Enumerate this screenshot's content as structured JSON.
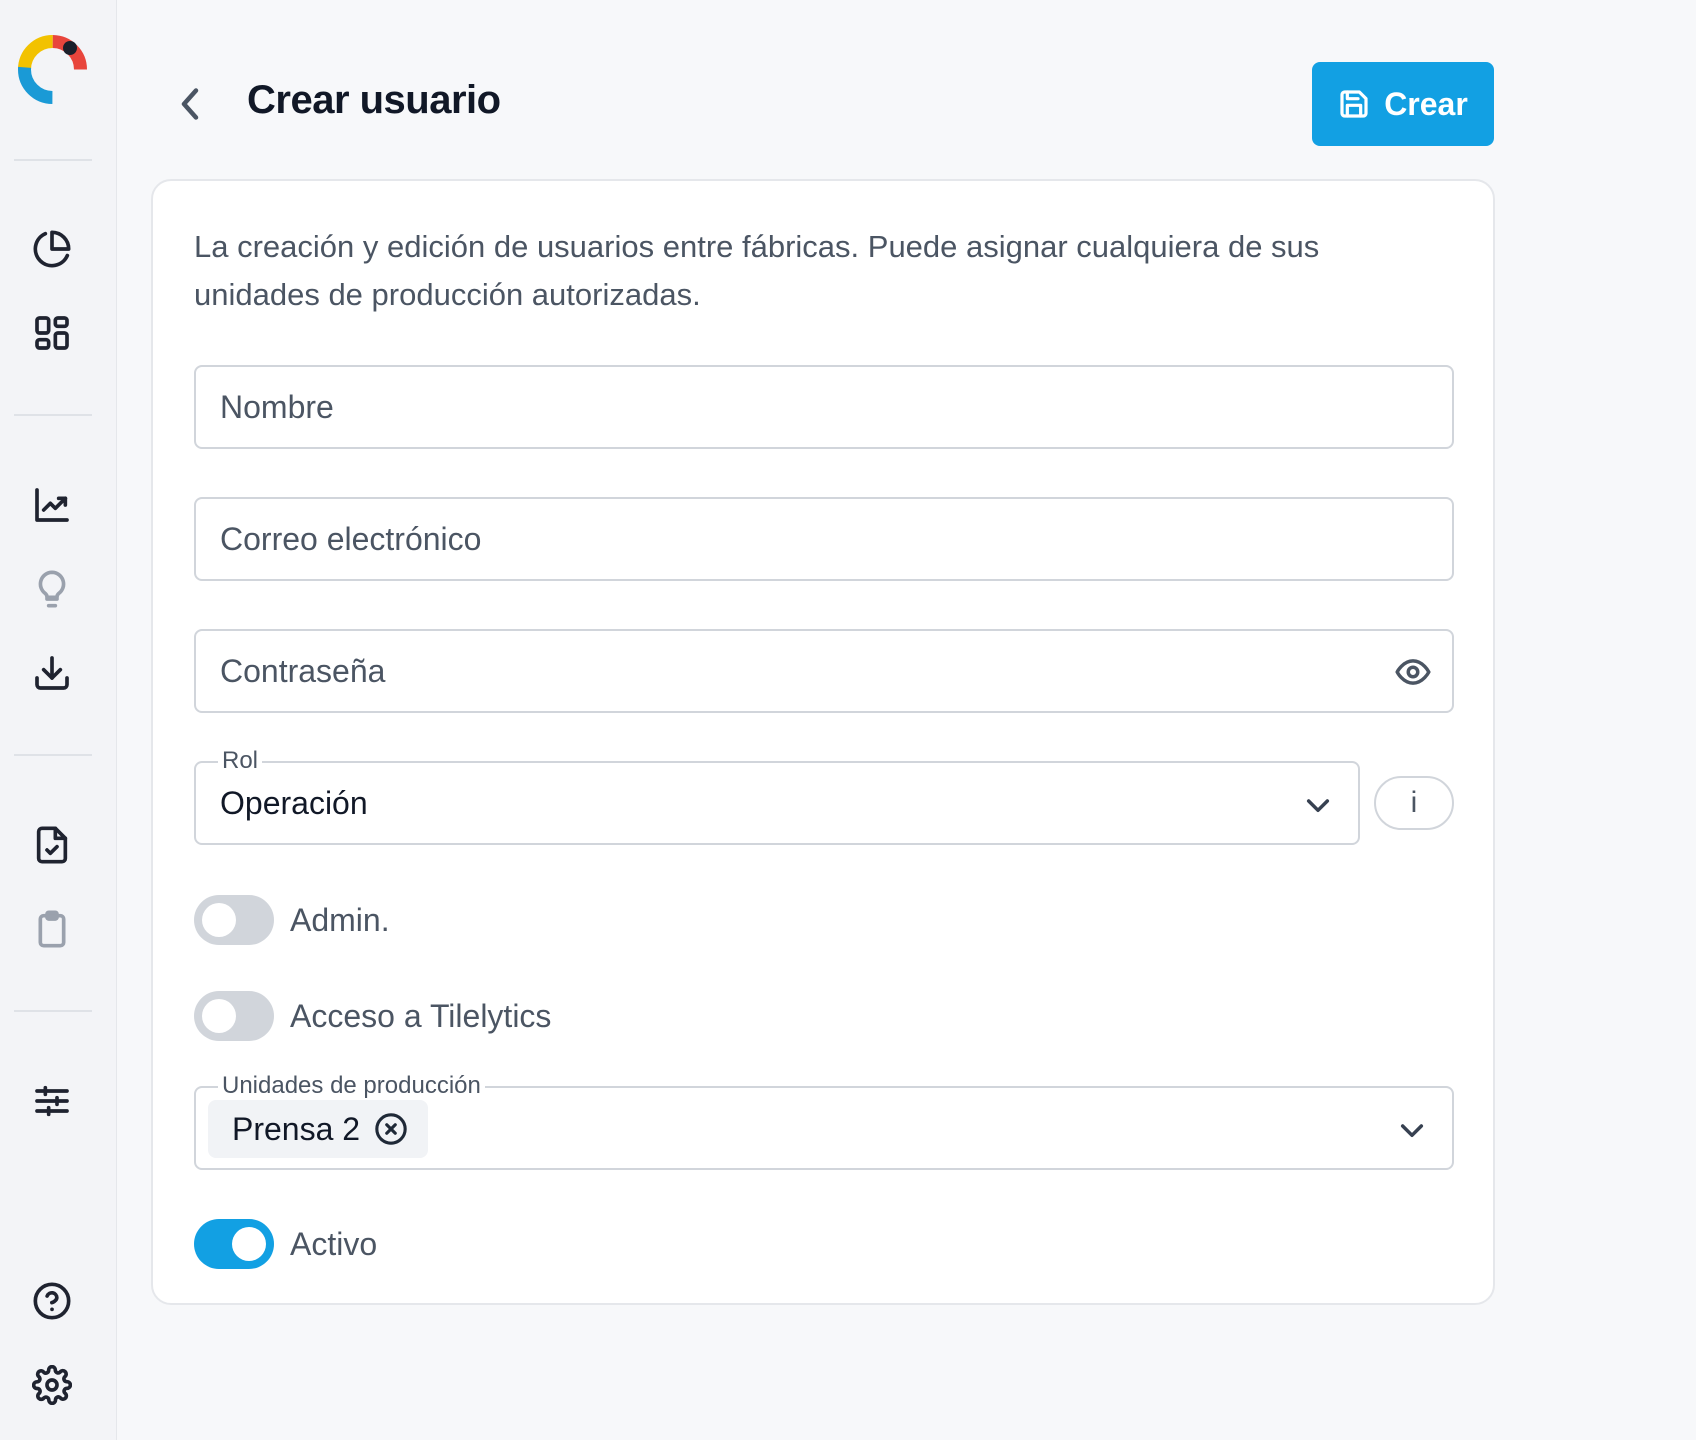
{
  "sidebar": {
    "icons": [
      "pie-chart-icon",
      "dashboard-grid-icon",
      "trend-chart-icon",
      "lightbulb-icon",
      "download-icon",
      "file-check-icon",
      "clipboard-icon",
      "sliders-icon",
      "help-icon",
      "settings-icon"
    ]
  },
  "header": {
    "title": "Crear usuario",
    "create_label": "Crear"
  },
  "form": {
    "description": "La creación y edición de usuarios entre fábricas. Puede asignar cualquiera de sus unidades de producción autorizadas.",
    "name_placeholder": "Nombre",
    "email_placeholder": "Correo electrónico",
    "password_placeholder": "Contraseña",
    "role": {
      "label": "Rol",
      "value": "Operación"
    },
    "info_label": "i",
    "admin": {
      "label": "Admin.",
      "checked": false
    },
    "tilelytics": {
      "label": "Acceso a Tilelytics",
      "checked": false
    },
    "units": {
      "label": "Unidades de producción",
      "selected": [
        "Prensa 2"
      ]
    },
    "active": {
      "label": "Activo",
      "checked": true
    }
  },
  "colors": {
    "accent": "#12a0e3",
    "toggle_off": "#d1d5db",
    "background": "#f7f8fa"
  }
}
